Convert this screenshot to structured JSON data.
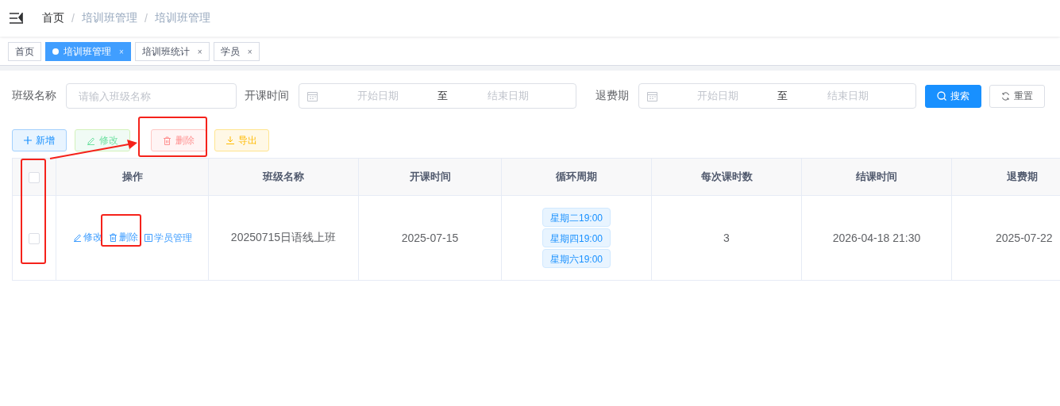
{
  "breadcrumb": [
    {
      "label": "首页"
    },
    {
      "separator": "/",
      "label": "培训班管理"
    },
    {
      "separator": "/",
      "label": "培训班管理"
    }
  ],
  "tabs": [
    {
      "label": "首页",
      "selected": false
    },
    {
      "label": "培训班管理",
      "selected": true,
      "close": "×"
    },
    {
      "label": "培训班统计",
      "selected": false,
      "close": "×"
    },
    {
      "label": "学员",
      "selected": false,
      "close": "×"
    }
  ],
  "filters": [
    {
      "kind": "text",
      "label": "班级名称",
      "placeholder": "请输入班级名称"
    },
    {
      "kind": "range",
      "label": "开课时间",
      "start": "开始日期",
      "separator": "至",
      "end": "结束日期"
    },
    {
      "kind": "range",
      "label": "退费期",
      "start": "开始日期",
      "separator": "至",
      "end": "结束日期"
    }
  ],
  "search_button": "搜索",
  "reset_button": "重置",
  "toolbar": [
    {
      "kind": "add",
      "label": "新增",
      "disabled": false
    },
    {
      "kind": "edit",
      "label": "修改",
      "disabled": true
    },
    {
      "kind": "delete",
      "label": "删除",
      "disabled": true
    },
    {
      "kind": "export",
      "label": "导出",
      "disabled": false
    }
  ],
  "table": {
    "all_checked": false,
    "columns": [
      "操作",
      "班级名称",
      "开课时间",
      "循环周期",
      "每次课时数",
      "结课时间",
      "退费期"
    ],
    "rows": [
      {
        "checked": false,
        "actions": [
          {
            "kind": "edit",
            "label": "修改"
          },
          {
            "kind": "delete",
            "label": "删除"
          },
          {
            "kind": "students",
            "label": "学员管理"
          }
        ],
        "name": "20250715日语线上班",
        "start": "2025-07-15",
        "schedule": [
          "星期二19:00",
          "星期四19:00",
          "星期六19:00"
        ],
        "hours": "3",
        "end": "2026-04-18 21:30",
        "refund": "2025-07-22"
      }
    ]
  }
}
